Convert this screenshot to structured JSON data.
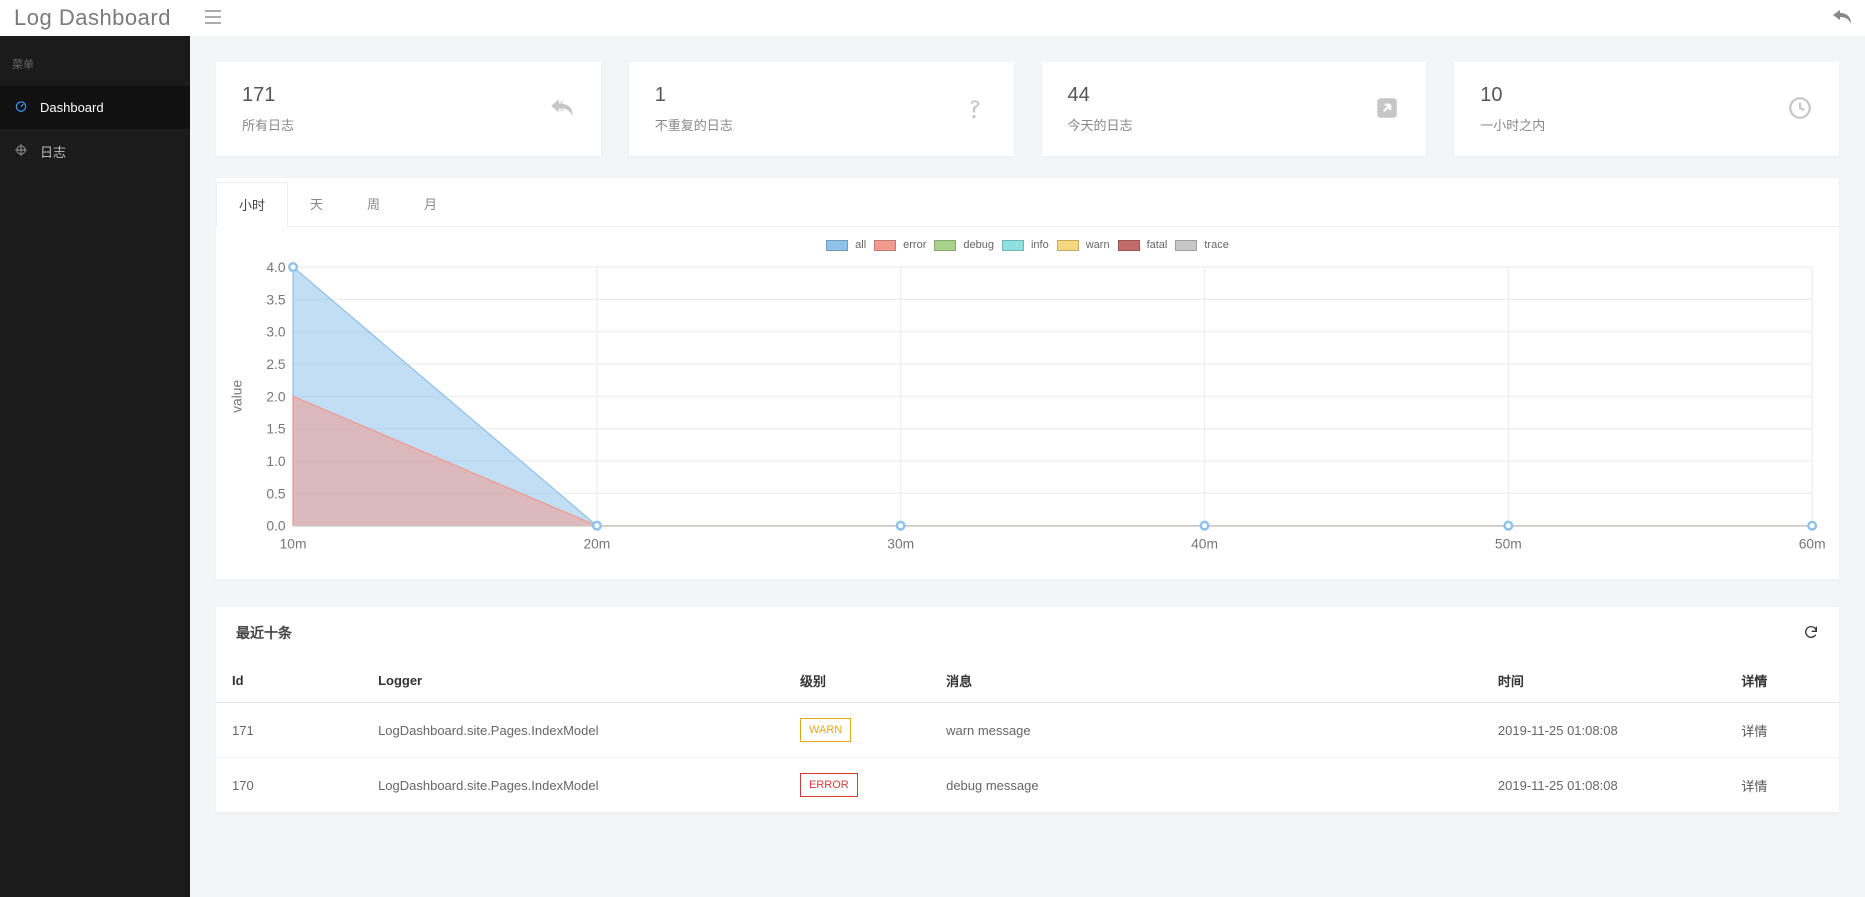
{
  "brand": "Log Dashboard",
  "sidebar": {
    "menu_label": "菜单",
    "items": [
      {
        "label": "Dashboard"
      },
      {
        "label": "日志"
      }
    ]
  },
  "cards": [
    {
      "value": "171",
      "caption": "所有日志",
      "icon": "reply-all-icon"
    },
    {
      "value": "1",
      "caption": "不重复的日志",
      "icon": "question-icon"
    },
    {
      "value": "44",
      "caption": "今天的日志",
      "icon": "share-icon"
    },
    {
      "value": "10",
      "caption": "一小时之内",
      "icon": "clock-icon"
    }
  ],
  "tabs": [
    {
      "label": "小时",
      "active": true
    },
    {
      "label": "天",
      "active": false
    },
    {
      "label": "周",
      "active": false
    },
    {
      "label": "月",
      "active": false
    }
  ],
  "recent": {
    "title": "最近十条",
    "columns": {
      "id": "Id",
      "logger": "Logger",
      "level": "级别",
      "msg": "消息",
      "time": "时间",
      "detail": "详情"
    },
    "detail_label": "详情",
    "rows": [
      {
        "id": "171",
        "logger": "LogDashboard.site.Pages.IndexModel",
        "level": "WARN",
        "level_cls": "badge-warn",
        "msg": "warn message",
        "time": "2019-11-25 01:08:08"
      },
      {
        "id": "170",
        "logger": "LogDashboard.site.Pages.IndexModel",
        "level": "ERROR",
        "level_cls": "badge-error",
        "msg": "debug message",
        "time": "2019-11-25 01:08:08"
      }
    ]
  },
  "chart_data": {
    "type": "area",
    "ylabel": "value",
    "ylim": [
      0,
      4
    ],
    "yticks": [
      0,
      0.5,
      1.0,
      1.5,
      2.0,
      2.5,
      3.0,
      3.5,
      4.0
    ],
    "categories": [
      "10m",
      "20m",
      "30m",
      "40m",
      "50m",
      "60m"
    ],
    "legend": [
      {
        "name": "all",
        "color": "#8fc2eb"
      },
      {
        "name": "error",
        "color": "#f29a8f"
      },
      {
        "name": "debug",
        "color": "#a9d28a"
      },
      {
        "name": "info",
        "color": "#8fe0e0"
      },
      {
        "name": "warn",
        "color": "#f4d67e"
      },
      {
        "name": "fatal",
        "color": "#c06a6a"
      },
      {
        "name": "trace",
        "color": "#c7c7c7"
      }
    ],
    "series": [
      {
        "name": "all",
        "color": "#8fc2eb",
        "values": [
          4,
          0,
          0,
          0,
          0,
          0
        ]
      },
      {
        "name": "error",
        "color": "#f29a8f",
        "values": [
          2,
          0,
          0,
          0,
          0,
          0
        ]
      },
      {
        "name": "debug",
        "color": "#a9d28a",
        "values": [
          0,
          0,
          0,
          0,
          0,
          0
        ]
      },
      {
        "name": "info",
        "color": "#8fe0e0",
        "values": [
          0,
          0,
          0,
          0,
          0,
          0
        ]
      },
      {
        "name": "warn",
        "color": "#f4d67e",
        "values": [
          0,
          0,
          0,
          0,
          0,
          0
        ]
      },
      {
        "name": "fatal",
        "color": "#c06a6a",
        "values": [
          0,
          0,
          0,
          0,
          0,
          0
        ]
      },
      {
        "name": "trace",
        "color": "#c7c7c7",
        "values": [
          0,
          0,
          0,
          0,
          0,
          0
        ]
      }
    ]
  }
}
